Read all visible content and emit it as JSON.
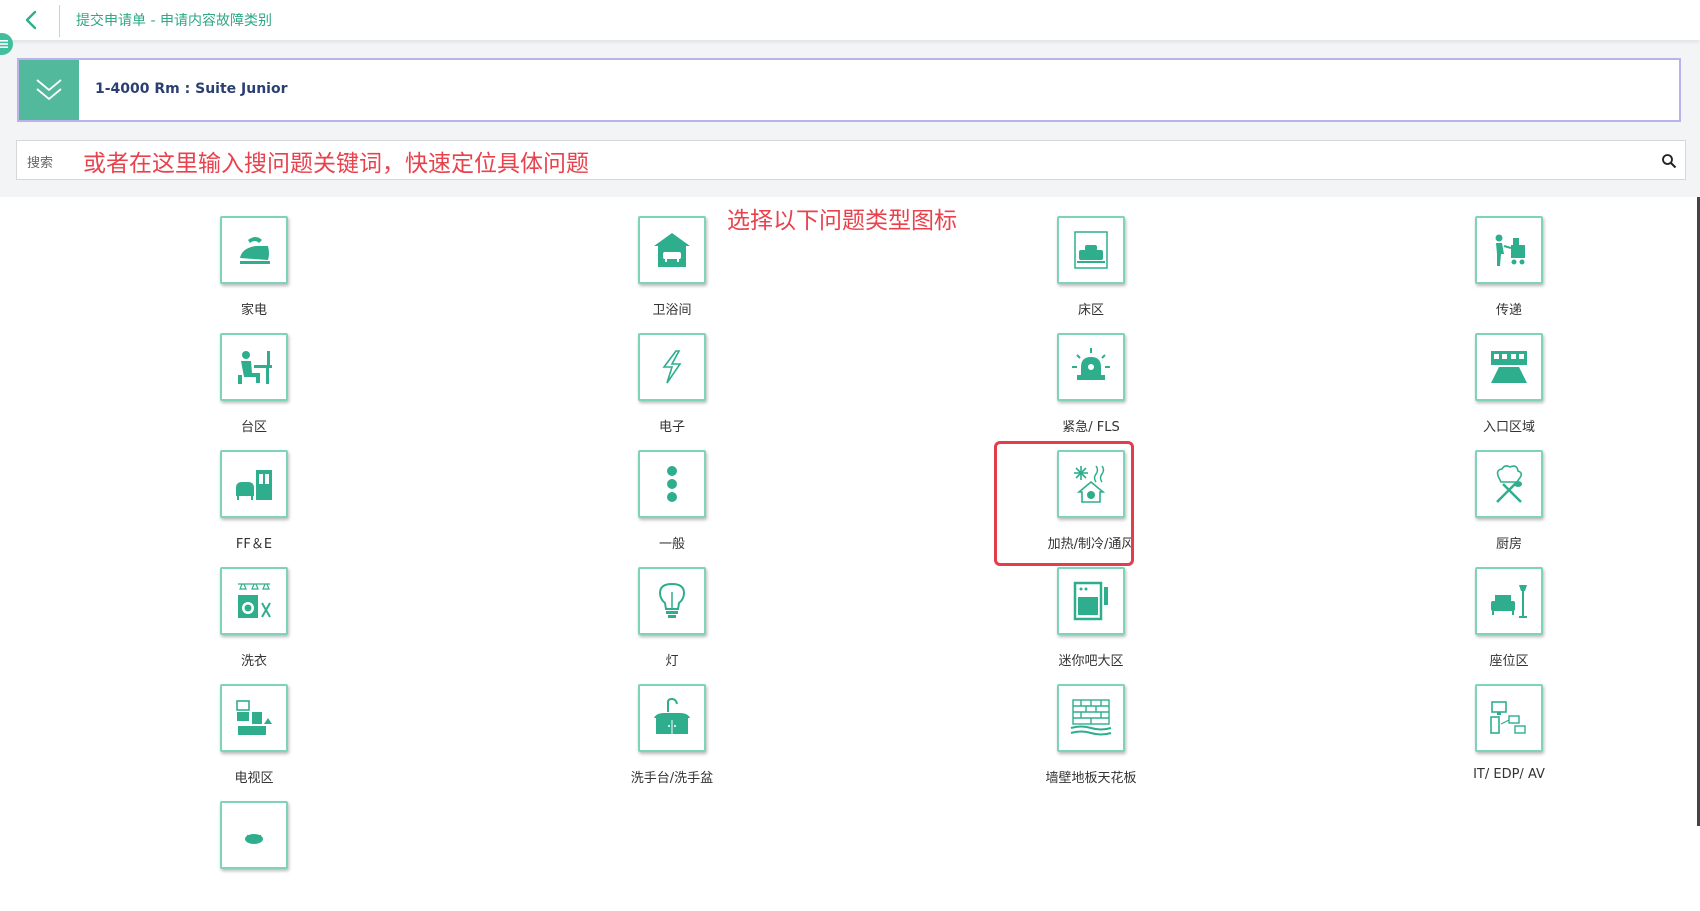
{
  "header": {
    "breadcrumb": "提交申请单 - 申请内容故障类别",
    "back_icon": "chevron-left-icon",
    "menu_icon": "menu-icon"
  },
  "room": {
    "label": "1-4000 Rm : Suite Junior",
    "toggle_icon": "double-chevron-down-icon"
  },
  "search": {
    "label": "搜索",
    "value": "",
    "placeholder": "",
    "hint": "或者在这里输入搜问题关键词，快速定位具体问题",
    "icon": "search-icon"
  },
  "grid_hint": "选择以下问题类型图标",
  "colors": {
    "accent": "#53b99c",
    "icon": "#2fae8e",
    "tile_border": "#7ed4bb",
    "annotation": "#e8424d",
    "highlight": "#e23d4c",
    "room_text": "#2b3f73"
  },
  "categories": [
    {
      "label": "家电",
      "icon": "iron-icon"
    },
    {
      "label": "卫浴间",
      "icon": "bathtub-house-icon"
    },
    {
      "label": "床区",
      "icon": "bed-icon"
    },
    {
      "label": "传递",
      "icon": "delivery-cart-icon"
    },
    {
      "label": "台区",
      "icon": "desk-person-icon"
    },
    {
      "label": "电子",
      "icon": "lightning-icon"
    },
    {
      "label": "紧急/ FLS",
      "icon": "alarm-light-icon"
    },
    {
      "label": "入口区域",
      "icon": "entrance-icon"
    },
    {
      "label": "FF＆E",
      "icon": "furniture-icon"
    },
    {
      "label": "一般",
      "icon": "dots-icon"
    },
    {
      "label": "加热/制冷/通风",
      "icon": "hvac-icon",
      "highlighted": true
    },
    {
      "label": "厨房",
      "icon": "chef-hat-utensils-icon"
    },
    {
      "label": "洗衣",
      "icon": "washing-machine-icon"
    },
    {
      "label": "灯",
      "icon": "light-bulb-icon"
    },
    {
      "label": "迷你吧大区",
      "icon": "minibar-fridge-icon"
    },
    {
      "label": "座位区",
      "icon": "sofa-lamp-icon"
    },
    {
      "label": "电视区",
      "icon": "tv-area-icon"
    },
    {
      "label": "洗手台/洗手盆",
      "icon": "sink-icon"
    },
    {
      "label": "墙壁地板天花板",
      "icon": "brick-wall-icon"
    },
    {
      "label": "IT/ EDP/ AV",
      "icon": "it-devices-icon"
    },
    {
      "label": "",
      "icon": "hat-icon"
    }
  ]
}
